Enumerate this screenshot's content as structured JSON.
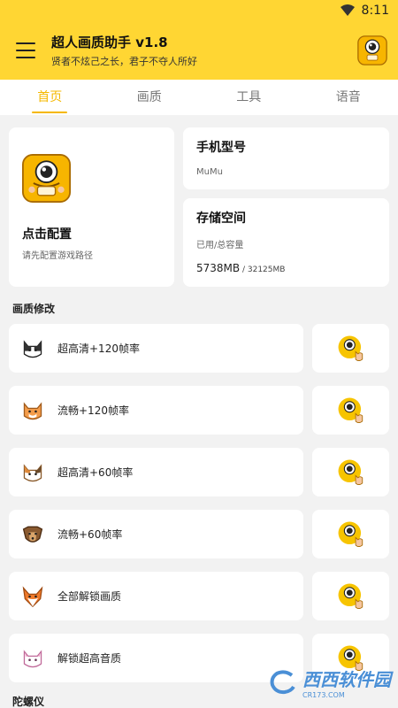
{
  "status_bar": {
    "time": "8:11"
  },
  "app_bar": {
    "title": "超人画质助手 v1.8",
    "subtitle": "贤者不炫己之长，君子不夺人所好",
    "menu_icon": "menu-icon",
    "logo_icon": "app-logo-icon"
  },
  "tabs": [
    {
      "label": "首页",
      "active": true
    },
    {
      "label": "画质",
      "active": false
    },
    {
      "label": "工具",
      "active": false
    },
    {
      "label": "语音",
      "active": false
    }
  ],
  "config_card": {
    "title": "点击配置",
    "subtitle": "请先配置游戏路径"
  },
  "model_card": {
    "title": "手机型号",
    "value": "MuMu"
  },
  "storage_card": {
    "title": "存储空间",
    "label": "已用/总容量",
    "used": "5738MB",
    "total": " / 32125MB"
  },
  "quality_section": {
    "title": "画质修改",
    "items": [
      {
        "label": "超高清+120帧率",
        "icon": "black-white-cat-icon"
      },
      {
        "label": "流畅+120帧率",
        "icon": "orange-cat-icon"
      },
      {
        "label": "超高清+60帧率",
        "icon": "calico-cat-icon"
      },
      {
        "label": "流畅+60帧率",
        "icon": "dog-icon"
      },
      {
        "label": "全部解锁画质",
        "icon": "fox-icon"
      },
      {
        "label": "解锁超高音质",
        "icon": "white-cat-icon"
      }
    ]
  },
  "gyro_section": {
    "title": "陀螺仪"
  },
  "watermark": {
    "text": "西西软件园",
    "url": "CR173.COM"
  },
  "colors": {
    "accent": "#ffd633",
    "tab_active": "#f5b800",
    "background": "#f2f2f2"
  }
}
